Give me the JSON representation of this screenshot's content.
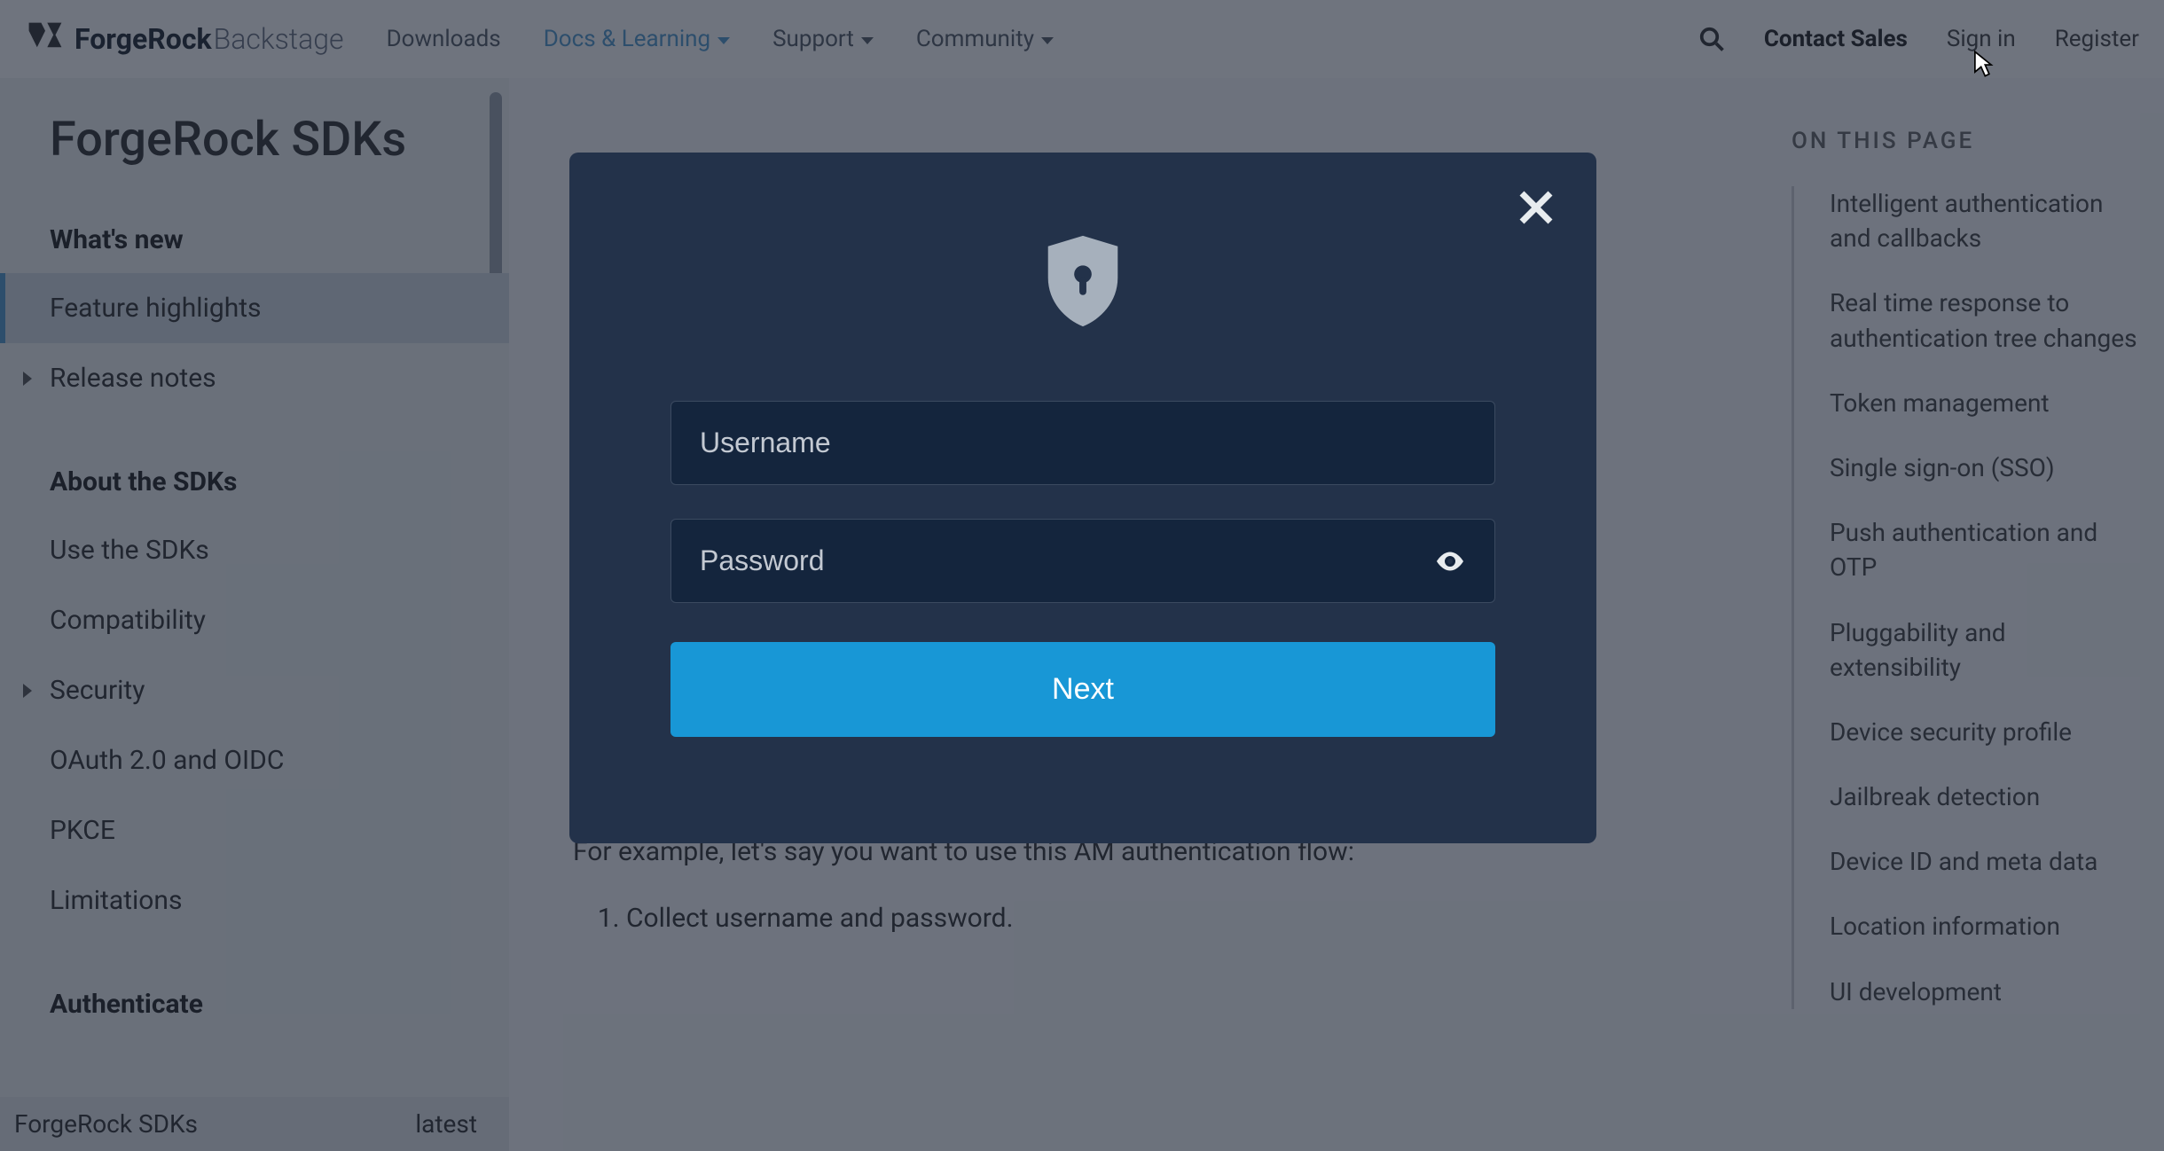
{
  "header": {
    "logo_main": "ForgeRock",
    "logo_sub": "Backstage",
    "menu": [
      {
        "label": "Downloads",
        "dropdown": false,
        "active": false
      },
      {
        "label": "Docs & Learning",
        "dropdown": true,
        "active": true
      },
      {
        "label": "Support",
        "dropdown": true,
        "active": false
      },
      {
        "label": "Community",
        "dropdown": true,
        "active": false
      }
    ],
    "contact_sales": "Contact Sales",
    "sign_in": "Sign in",
    "register": "Register"
  },
  "sidebar": {
    "title": "ForgeRock SDKs",
    "sections": [
      {
        "heading": "What's new",
        "items": [
          {
            "label": "Feature highlights",
            "active": true,
            "caret": false
          },
          {
            "label": "Release notes",
            "active": false,
            "caret": true
          }
        ]
      },
      {
        "heading": "About the SDKs",
        "items": [
          {
            "label": "Use the SDKs",
            "active": false,
            "caret": false
          },
          {
            "label": "Compatibility",
            "active": false,
            "caret": false
          },
          {
            "label": "Security",
            "active": false,
            "caret": true
          },
          {
            "label": "OAuth 2.0 and OIDC",
            "active": false,
            "caret": false
          },
          {
            "label": "PKCE",
            "active": false,
            "caret": false
          },
          {
            "label": "Limitations",
            "active": false,
            "caret": false
          }
        ]
      },
      {
        "heading": "Authenticate",
        "items": []
      }
    ],
    "footer_left": "ForgeRock SDKs",
    "footer_right": "latest"
  },
  "main": {
    "p_example": "For example, let's say you want to use this AM authentication flow:",
    "ol_1": "Collect username and password."
  },
  "onpage": {
    "title": "ON THIS PAGE",
    "items": [
      "Intelligent authentication and callbacks",
      "Real time response to authentication tree changes",
      "Token management",
      "Single sign-on (SSO)",
      "Push authentication and OTP",
      "Pluggability and extensibility",
      "Device security profile",
      "Jailbreak detection",
      "Device ID and meta data",
      "Location information",
      "UI development"
    ]
  },
  "modal": {
    "username_placeholder": "Username",
    "password_placeholder": "Password",
    "next_label": "Next"
  }
}
